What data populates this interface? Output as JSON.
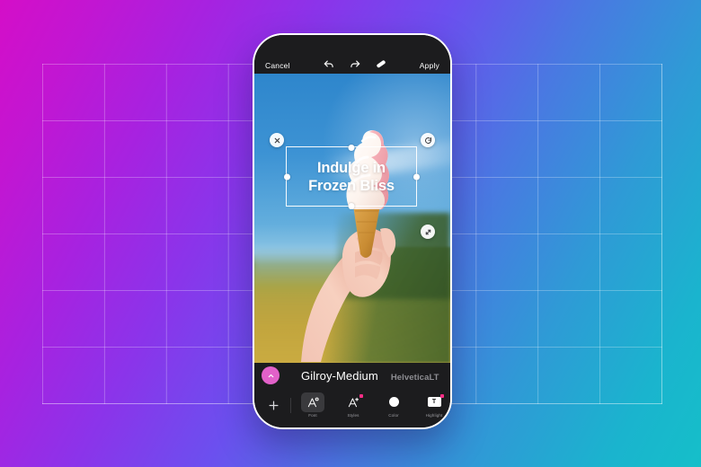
{
  "background": {
    "gradient_from": "#d40ec8",
    "gradient_mid": "#6b50ef",
    "gradient_to": "#15bfc9",
    "grid_color": "#ffffff"
  },
  "phone": {
    "topbar": {
      "cancel_label": "Cancel",
      "apply_label": "Apply",
      "undo_icon": "undo-icon",
      "redo_icon": "redo-icon",
      "eraser_icon": "eraser-icon"
    },
    "canvas": {
      "photo_description": "hand holding swirled ice cream cone against blue sky and field",
      "text_overlay": {
        "line1": "Indulge in",
        "line2": "Frozen Bliss",
        "color": "#ffffff"
      },
      "controls": {
        "close_icon": "close-icon",
        "rotate_icon": "rotate-icon",
        "resize_icon": "resize-icon"
      }
    },
    "fontbar": {
      "collapse_icon": "chevron-up-icon",
      "collapse_color": "#e261c9",
      "fonts": [
        {
          "name": "Gilroy-Medium",
          "selected": true
        },
        {
          "name": "HelveticaLT",
          "selected": false
        }
      ]
    },
    "toolbar": {
      "add_icon": "plus-icon",
      "tools": [
        {
          "label": "Font",
          "icon": "font-icon",
          "active": true,
          "badge": false
        },
        {
          "label": "Styles",
          "icon": "styles-icon",
          "active": false,
          "badge": true
        },
        {
          "label": "Color",
          "icon": "color-icon",
          "active": false,
          "badge": false
        },
        {
          "label": "Highlight",
          "icon": "highlight-icon",
          "active": false,
          "badge": true
        }
      ]
    }
  }
}
